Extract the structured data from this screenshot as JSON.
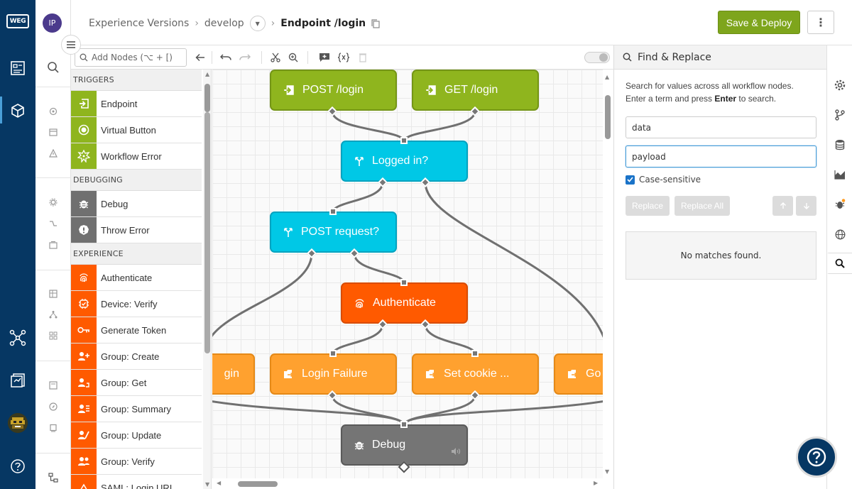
{
  "breadcrumb": {
    "root": "Experience Versions",
    "branch": "develop",
    "current": "Endpoint /login",
    "sep": "›"
  },
  "header": {
    "avatar_initials": "IP",
    "save_label": "Save & Deploy",
    "more_label": "⋮"
  },
  "toolbar": {
    "add_nodes_placeholder": "Add Nodes (⌥ + [)"
  },
  "palette": {
    "sections": [
      {
        "label": "TRIGGERS",
        "color": "#8fb51e",
        "items": [
          {
            "label": "Endpoint",
            "icon": "endpoint-icon"
          },
          {
            "label": "Virtual Button",
            "icon": "virtual-button-icon"
          },
          {
            "label": "Workflow Error",
            "icon": "workflow-error-icon"
          }
        ]
      },
      {
        "label": "DEBUGGING",
        "color": "#707070",
        "items": [
          {
            "label": "Debug",
            "icon": "debug-bug-icon"
          },
          {
            "label": "Throw Error",
            "icon": "throw-error-icon"
          }
        ]
      },
      {
        "label": "EXPERIENCE",
        "color": "#ff5a00",
        "items": [
          {
            "label": "Authenticate",
            "icon": "fingerprint-icon"
          },
          {
            "label": "Device: Verify",
            "icon": "device-verify-icon"
          },
          {
            "label": "Generate Token",
            "icon": "key-icon"
          },
          {
            "label": "Group: Create",
            "icon": "group-create-icon"
          },
          {
            "label": "Group: Get",
            "icon": "group-get-icon"
          },
          {
            "label": "Group: Summary",
            "icon": "group-summary-icon"
          },
          {
            "label": "Group: Update",
            "icon": "group-update-icon"
          },
          {
            "label": "Group: Verify",
            "icon": "group-verify-icon"
          },
          {
            "label": "SAML: Login URL",
            "icon": "saml-icon"
          }
        ]
      }
    ]
  },
  "canvas": {
    "nodes": {
      "post_login": "POST /login",
      "get_login": "GET /login",
      "logged_in": "Logged in?",
      "post_request": "POST request?",
      "authenticate": "Authenticate",
      "redirect_login": "gin",
      "login_failure": "Login Failure",
      "set_cookie": "Set cookie ...",
      "go_to": "Go t",
      "debug": "Debug"
    }
  },
  "find_replace": {
    "title": "Find & Replace",
    "desc_line1": "Search for values across all workflow nodes.",
    "desc_pre": "Enter a term and press ",
    "desc_key": "Enter",
    "desc_post": " to search.",
    "find_value": "data",
    "replace_value": "payload",
    "case_label": "Case-sensitive",
    "case_checked": true,
    "replace_label": "Replace",
    "replace_all_label": "Replace All",
    "results_text": "No matches found."
  },
  "help_label": "?"
}
